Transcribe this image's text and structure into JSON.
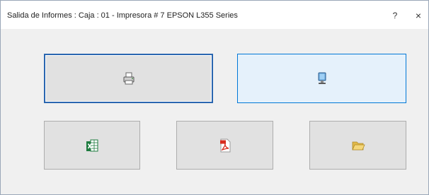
{
  "window": {
    "title": "Salida de Informes : Caja : 01 - Impresora #  7 EPSON L355 Series",
    "help_label": "?",
    "close_label": "×"
  },
  "buttons": [
    {
      "name": "print-button",
      "icon": "printer-icon"
    },
    {
      "name": "screen-button",
      "icon": "monitor-icon"
    },
    {
      "name": "excel-button",
      "icon": "excel-icon"
    },
    {
      "name": "pdf-button",
      "icon": "pdf-icon"
    },
    {
      "name": "folder-button",
      "icon": "folder-icon"
    }
  ],
  "colors": {
    "focus_border": "#2a66b0",
    "hover_bg": "#e5f1fb",
    "hover_border": "#0078d7",
    "button_bg": "#e1e1e1"
  }
}
